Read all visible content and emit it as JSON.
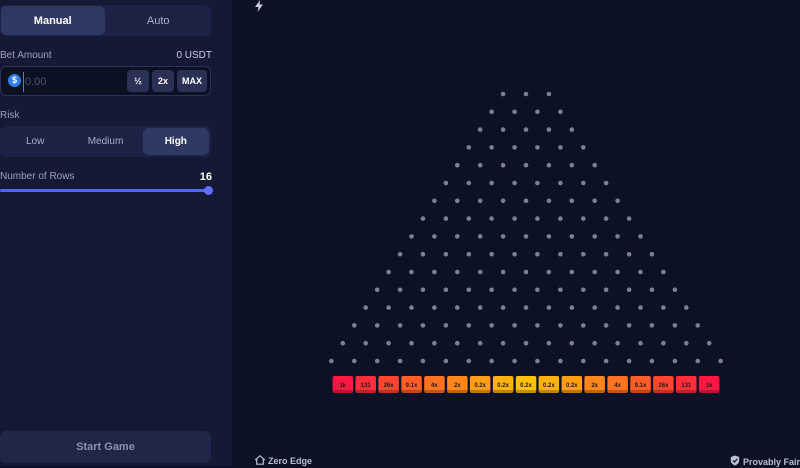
{
  "mode_tabs": [
    {
      "label": "Manual",
      "active": true
    },
    {
      "label": "Auto",
      "active": false
    }
  ],
  "bet": {
    "label": "Bet Amount",
    "balance": "0 USDT",
    "currency_icon": "dollar-coin-icon",
    "value": "",
    "placeholder": "0.00",
    "half_label": "½",
    "double_label": "2x",
    "max_label": "MAX"
  },
  "risk": {
    "label": "Risk",
    "options": [
      {
        "label": "Low",
        "active": false
      },
      {
        "label": "Medium",
        "active": false
      },
      {
        "label": "High",
        "active": true
      }
    ]
  },
  "rows": {
    "label": "Number of Rows",
    "value": "16",
    "slider_fraction": 1.0
  },
  "start_button": "Start Game",
  "board": {
    "peg_rows": 16,
    "first_row_pegs": 3,
    "multipliers": [
      "1k",
      "131",
      "26x",
      "9.1x",
      "4x",
      "2x",
      "0.2x",
      "0.2x",
      "0.2x",
      "0.2x",
      "0.2x",
      "2x",
      "4x",
      "9.1x",
      "26x",
      "131",
      "1k"
    ],
    "slot_colors": [
      "#ff1744",
      "#ff2d3a",
      "#ff4530",
      "#ff5d27",
      "#ff7220",
      "#ff861a",
      "#ff9d14",
      "#ffb10e",
      "#ffc10b",
      "#ffb10e",
      "#ff9d14",
      "#ff861a",
      "#ff7220",
      "#ff5d27",
      "#ff4530",
      "#ff2d3a",
      "#ff1744"
    ],
    "peg_color": "#7b8099"
  },
  "footer": {
    "zero_edge": "Zero Edge",
    "provably_fair": "Provably Fair"
  },
  "icons": {
    "bolt": "bolt-icon",
    "zero_edge": "house-icon",
    "provably_fair": "shield-check-icon"
  }
}
